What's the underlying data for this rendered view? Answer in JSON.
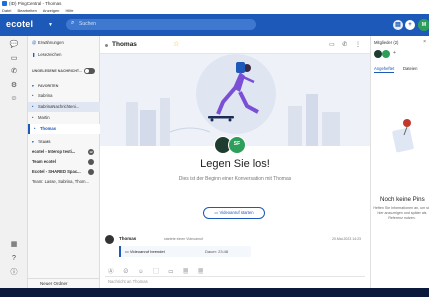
{
  "titlebar": {
    "app_title": "(ID) PingCentral - Thomas",
    "menus": [
      "Datei",
      "Bearbeiten",
      "Anzeigen",
      "Hilfe"
    ]
  },
  "header": {
    "brand": "ecotel",
    "search_placeholder": "Suchen",
    "avatar_initials": "M"
  },
  "rail": {
    "icons": [
      "chat-icon",
      "video-icon",
      "phone-icon",
      "settings-icon",
      "contacts-icon",
      "calendar-icon",
      "help-icon",
      "info-icon"
    ]
  },
  "sidebar": {
    "mentions": "Erwähnungen",
    "bookmarks": "Lesezeichen",
    "unread_label": "UNGELESENE NACHRICHT...",
    "favorites_header": "FAVORITEN",
    "favorites": [
      "Sabrina",
      "SabrinaNachrichteni...",
      "Martin",
      "Thomas"
    ],
    "teams_header": "TEAMS",
    "teams": [
      {
        "label": "ecotel - Interop testi...",
        "badge": "12"
      },
      {
        "label": "Team ecotel",
        "badge": ""
      },
      {
        "label": "Ecotel - SHARED Spac...",
        "badge": ""
      },
      {
        "label": "Team: Lasse, Sabrina, Thom...",
        "badge": ""
      }
    ],
    "footer": "Neuer Ordner"
  },
  "chat": {
    "title": "Thomas",
    "welcome_title": "Legen Sie los!",
    "welcome_sub": "Dies ist der Beginn einer Konversation mit Thomas",
    "avatar_initials": "SF",
    "video_button": "Videoanruf starten",
    "message": {
      "author": "Thomas",
      "action": "startete einen Videoanruf",
      "time": "20.Mai.2023 14:23",
      "card_text": "Videoanruf beendet",
      "duration": "Dauer: 23:48"
    },
    "composer_placeholder": "Nachricht an Thomas"
  },
  "right_panel": {
    "members": "Mitglieder (2)",
    "tab_pinned": "Angeheftet",
    "tab_files": "Dateien",
    "empty_title": "Noch keine Pins",
    "empty_text": "Heften Sie Informationen an, um sie hier anzuzeigen und später als Referenz nutzen."
  },
  "colors": {
    "brand_blue": "#1c59b8",
    "avatar_green": "#2e9e5b",
    "star_yellow": "#f5b800"
  }
}
